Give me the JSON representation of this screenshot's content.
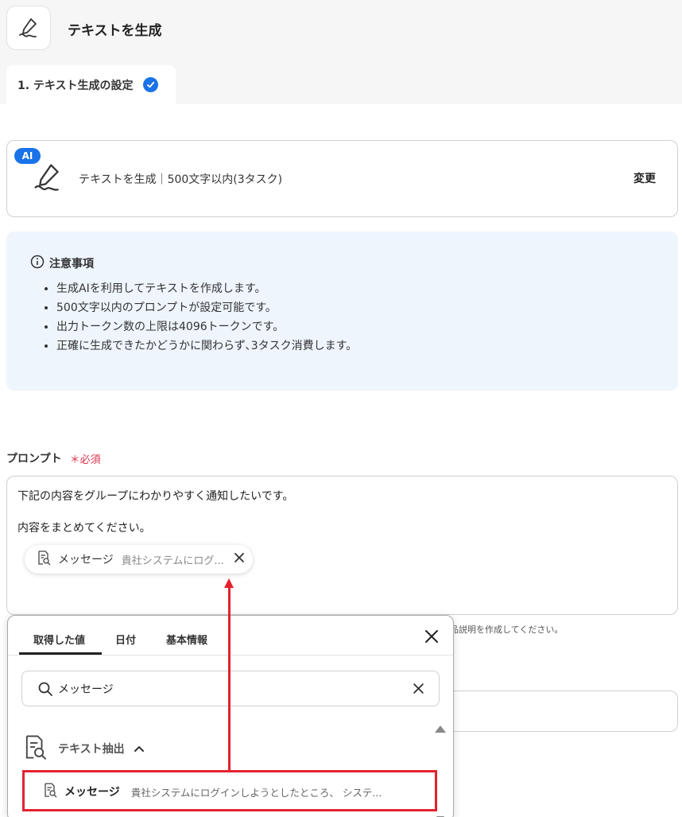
{
  "header": {
    "title": "テキストを生成",
    "step_tab": "1. テキスト生成の設定"
  },
  "action_card": {
    "badge": "AI",
    "description": "テキストを生成｜500文字以内(3タスク)",
    "change_label": "変更"
  },
  "notice": {
    "title": "注意事項",
    "items": [
      "生成AIを利用してテキストを作成します。",
      "500文字以内のプロンプトが設定可能です。",
      "出力トークン数の上限は4096トークンです。",
      "正確に生成できたかどうかに関わらず､3タスク消費します。"
    ]
  },
  "prompt": {
    "label": "プロンプト",
    "required": "＊必須",
    "line1": "下記の内容をグループにわかりやすく通知したいです。",
    "line2": "内容をまとめてください。",
    "chip_label": "メッセージ",
    "chip_value": "貴社システムにログ...",
    "hint_tail": "品説明を作成してください。"
  },
  "picker": {
    "tabs": [
      "取得した値",
      "日付",
      "基本情報"
    ],
    "search_value": "メッセージ",
    "group_label": "テキスト抽出",
    "result_label": "メッセージ",
    "result_value": "貴社システムにログインしようとしたところ、 システ..."
  },
  "colors": {
    "accent": "#1a73e8",
    "required": "#d9304b",
    "annotation": "#e3222e",
    "notice_bg": "#eef5fd"
  }
}
